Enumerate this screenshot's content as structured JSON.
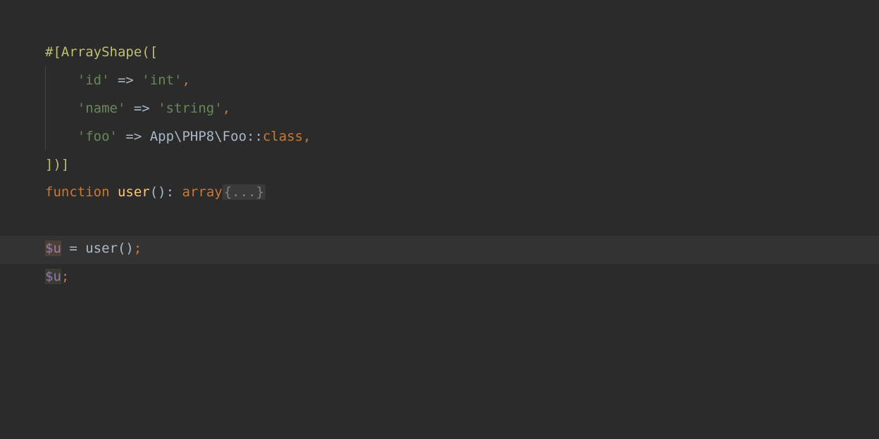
{
  "code": {
    "line1": {
      "attr_open": "#[ArrayShape([",
      "attr_open_full": "#[",
      "attr_name": "ArrayShape",
      "paren_bracket": "(["
    },
    "line2": {
      "indent": "    ",
      "key": "'id'",
      "arrow": " => ",
      "value": "'int'",
      "comma": ","
    },
    "line3": {
      "indent": "    ",
      "key": "'name'",
      "arrow": " => ",
      "value": "'string'",
      "comma": ","
    },
    "line4": {
      "indent": "    ",
      "key": "'foo'",
      "arrow": " => ",
      "class_path": "App\\PHP8\\Foo",
      "double_colon": "::",
      "class_kw": "class",
      "comma": ","
    },
    "line5": {
      "close": "])]"
    },
    "line6": {
      "fn_kw": "function ",
      "fn_name": "user",
      "parens": "()",
      "colon": ": ",
      "return_type": "array",
      "folded": "{...}"
    },
    "line8": {
      "var": "$u",
      "equals": " = ",
      "call": "user()",
      "semi": ";"
    },
    "line9": {
      "var": "$u",
      "semi": ";"
    }
  }
}
